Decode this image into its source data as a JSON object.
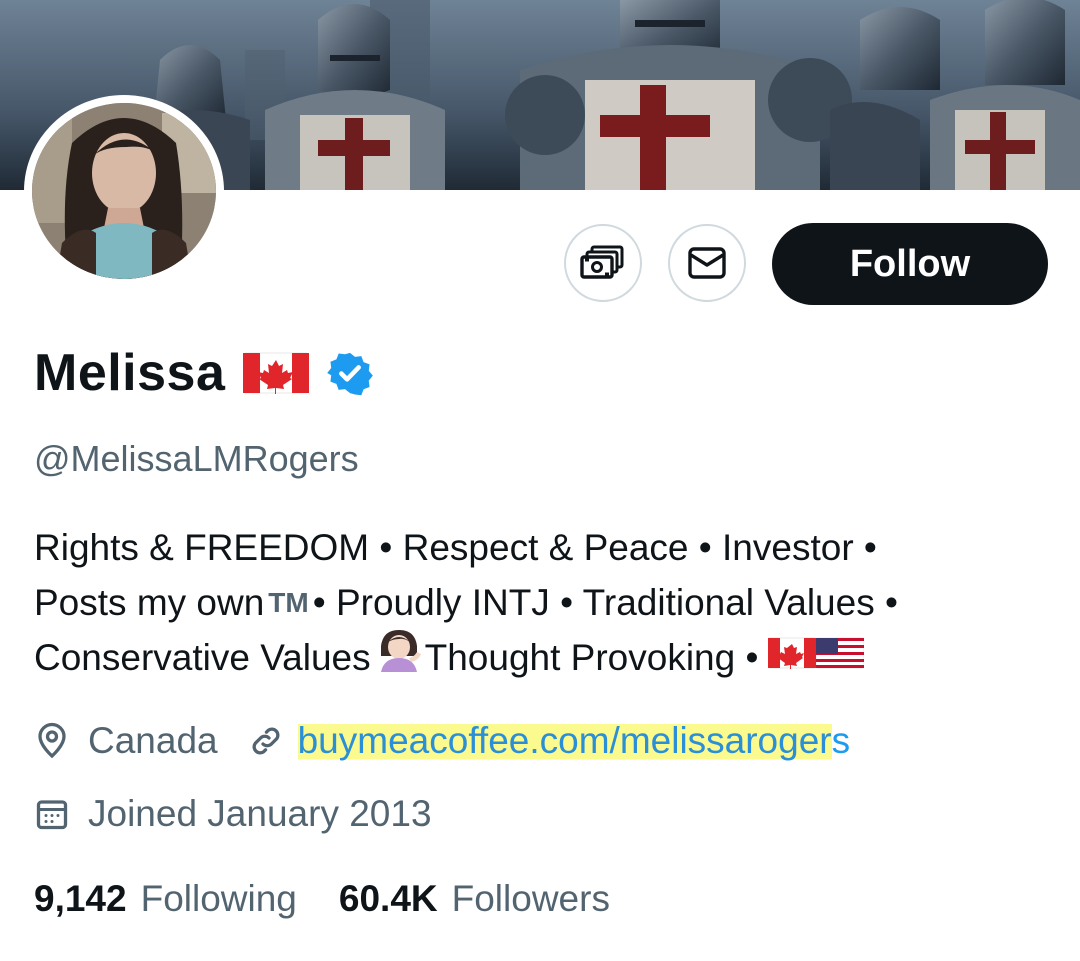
{
  "profile": {
    "name": "Melissa",
    "handle": "@MelissaLMRogers",
    "verified": true,
    "bio": {
      "line1": "Rights & FREEDOM • Respect & Peace • Investor •",
      "line2_a": "Posts my own",
      "line2_tm": "TM",
      "line2_b": "• Proudly INTJ • Traditional Values •",
      "line3_a": "Conservative Values",
      "line3_b": "Thought Provoking •"
    },
    "location": "Canada",
    "website_highlighted": "buymeacoffee.com/melissaroger",
    "website_rest": "s",
    "joined": "Joined January 2013",
    "following_count": "9,142",
    "following_label": "Following",
    "followers_count": "60.4K",
    "followers_label": "Followers"
  },
  "actions": {
    "follow_label": "Follow",
    "tip_icon": "money-icon",
    "message_icon": "envelope-icon"
  },
  "colors": {
    "accent": "#1d9bf0",
    "follow_bg": "#0f1419",
    "secondary_text": "#536471",
    "highlight": "#fbfa8e"
  }
}
